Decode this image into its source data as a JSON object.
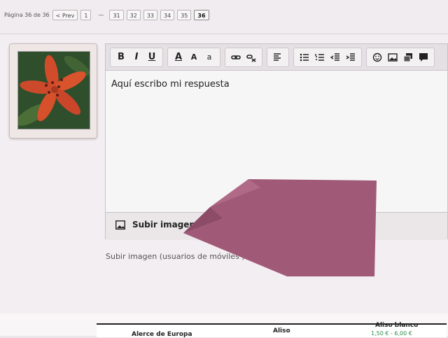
{
  "pagination": {
    "label": "Página 36 de 36",
    "prev": "< Prev",
    "first": "1",
    "separator": "—",
    "pages": [
      "31",
      "32",
      "33",
      "34",
      "35"
    ],
    "current": "36"
  },
  "avatar": {
    "icon": "lily-flower-photo"
  },
  "toolbar": {
    "bold": "B",
    "italic": "I",
    "underline": "U",
    "font_color": "A",
    "font_size": "A",
    "subscript": "a",
    "icons": [
      "link-icon",
      "unlink-icon",
      "align-left-icon",
      "bulleted-list-icon",
      "numbered-list-icon",
      "outdent-icon",
      "indent-icon",
      "smiley-icon",
      "image-icon",
      "gallery-icon",
      "quote-icon"
    ]
  },
  "editor": {
    "content": "Aquí escribo mi respuesta"
  },
  "upload": {
    "button_label": "Subir imagen",
    "mobile_link": "Subir imagen (usuarios de móviles )"
  },
  "table": {
    "columns": [
      "Alerce de Europa",
      "Aliso",
      "Aliso blanco"
    ],
    "price": "1,50 € - 6,00 €"
  },
  "colors": {
    "overlay": "#a05a78",
    "price": "#2f8a4a"
  }
}
